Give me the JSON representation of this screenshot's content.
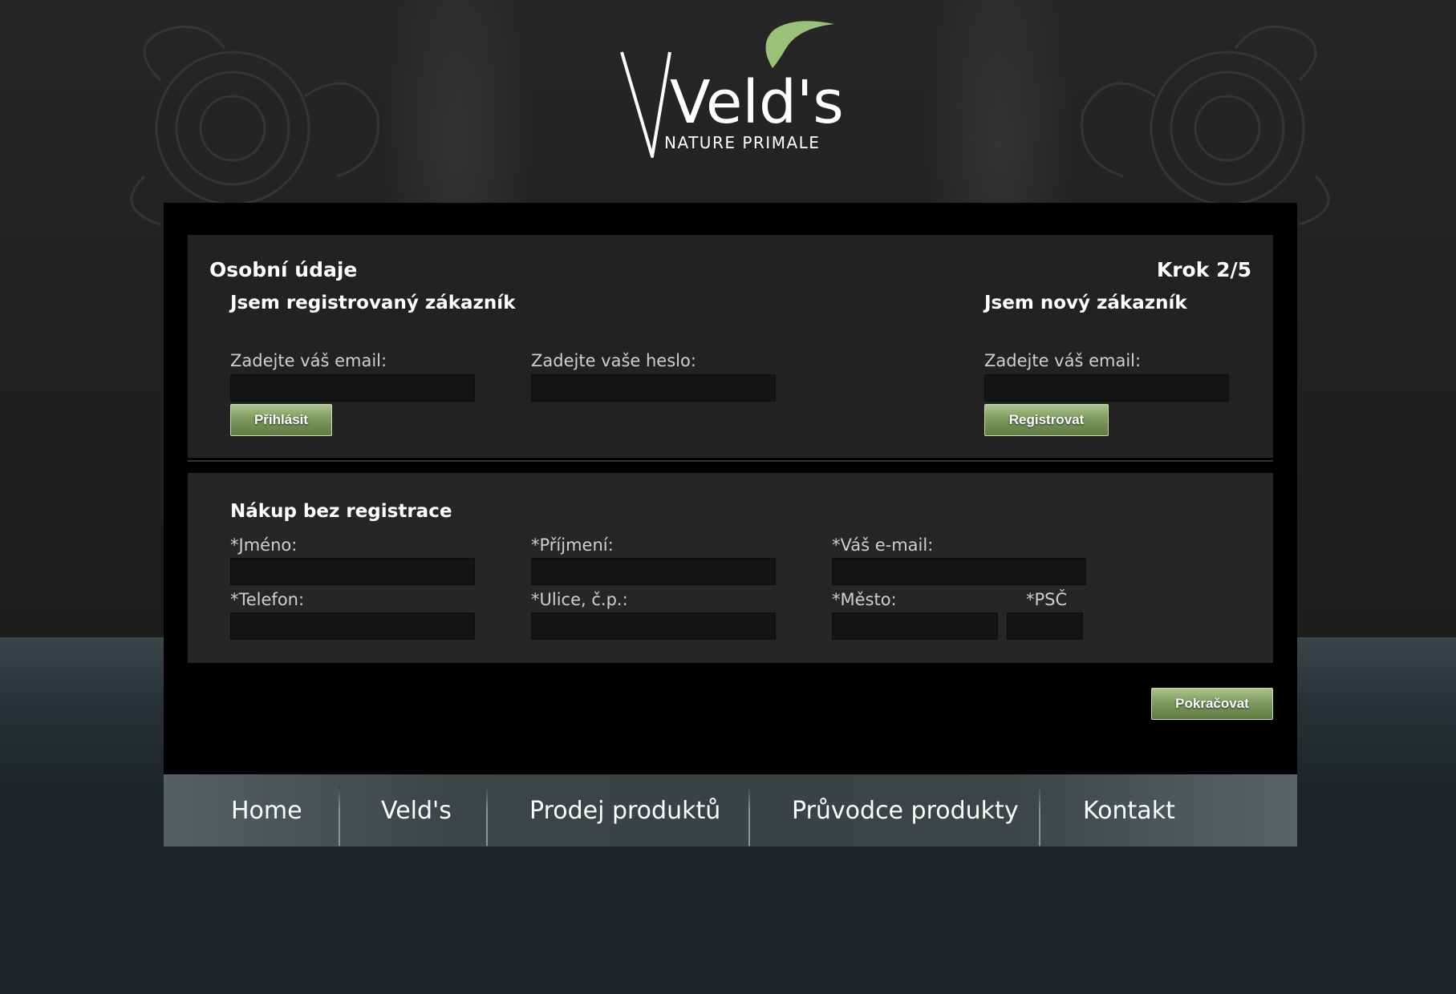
{
  "brand": {
    "logo_main": "Veld's",
    "logo_tagline": "NATURE PRIMALE",
    "colors": {
      "accent": "#9bc07a",
      "button_green": "#7d9b5f"
    }
  },
  "checkout": {
    "title": "Osobní údaje",
    "step": "Krok 2/5",
    "registered": {
      "heading": "Jsem registrovaný zákazník",
      "email_label": "Zadejte váš email:",
      "email_value": "",
      "password_label": "Zadejte vaše heslo:",
      "password_value": "",
      "login_button": "Přihlásit"
    },
    "new_customer": {
      "heading": "Jsem nový zákazník",
      "email_label": "Zadejte váš email:",
      "email_value": "",
      "register_button": "Registrovat"
    },
    "guest": {
      "heading": "Nákup bez registrace",
      "first_name_label": "*Jméno:",
      "last_name_label": "*Příjmení:",
      "email_label": "*Váš e-mail:",
      "phone_label": "*Telefon:",
      "street_label": "*Ulice, č.p.:",
      "city_label": "*Město:",
      "zip_label": "*PSČ"
    },
    "continue_button": "Pokračovat"
  },
  "nav": {
    "items": [
      "Home",
      "Veld's",
      "Prodej produktů",
      "Průvodce produkty",
      "Kontakt"
    ]
  }
}
